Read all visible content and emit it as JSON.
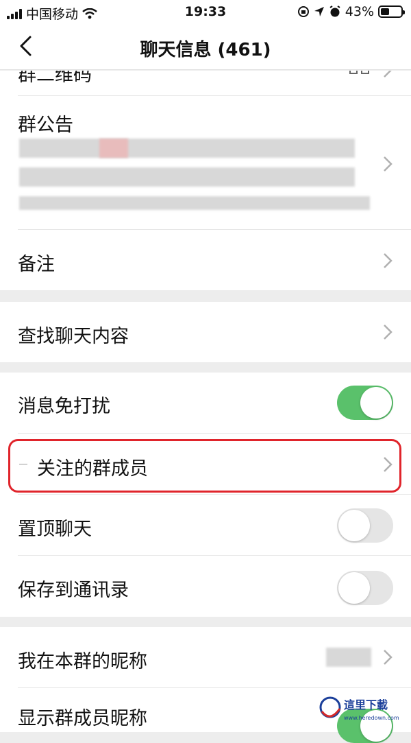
{
  "status": {
    "carrier": "中国移动",
    "time": "19:33",
    "battery": "43%"
  },
  "nav": {
    "title": "聊天信息 (461)"
  },
  "rows": {
    "partial_label": "群二维码",
    "announcement": "群公告",
    "remark": "备注",
    "search": "查找聊天内容",
    "mute": "消息免打扰",
    "focus_members": "关注的群成员",
    "pin": "置顶聊天",
    "save_contacts": "保存到通讯录",
    "my_nickname": "我在本群的昵称",
    "show_nicknames": "显示群成员昵称"
  },
  "toggles": {
    "mute": true,
    "pin": false,
    "save_contacts": false,
    "show_nicknames": true
  },
  "watermark": {
    "brand": "這里下載",
    "url": "www.heredown.com"
  },
  "colors": {
    "toggle_on": "#5ac16b",
    "highlight": "#e0242b"
  }
}
